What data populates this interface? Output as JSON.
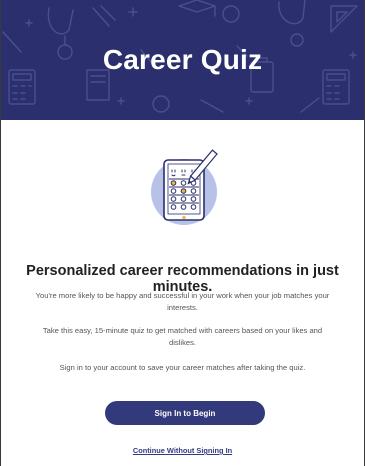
{
  "header": {
    "title": "Career Quiz",
    "background_color": "#2b2f6e"
  },
  "illustration": {
    "icon": "quiz-tablet-icon"
  },
  "content": {
    "headline": "Personalized career recommendations in just minutes.",
    "paragraphs": [
      "You're more likely to be happy and successful in your work when your job matches your interests.",
      "Take this easy, 15-minute quiz to get matched with careers based on your likes and dislikes.",
      "Sign in to your account to save your career matches after taking the quiz."
    ]
  },
  "actions": {
    "primary_label": "Sign In to Begin",
    "primary_color": "#323a7c",
    "secondary_label": "Continue Without Signing In"
  }
}
